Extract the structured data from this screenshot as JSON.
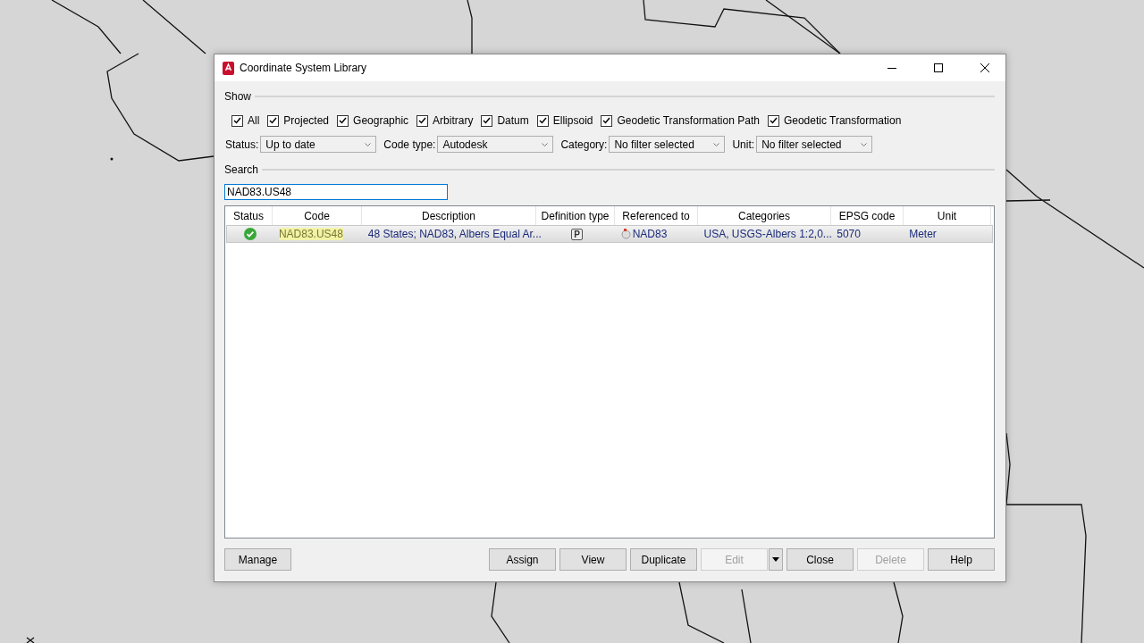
{
  "window": {
    "title": "Coordinate System Library"
  },
  "show": {
    "label": "Show",
    "filters": [
      {
        "label": "All",
        "checked": true
      },
      {
        "label": "Projected",
        "checked": true
      },
      {
        "label": "Geographic",
        "checked": true
      },
      {
        "label": "Arbitrary",
        "checked": true
      },
      {
        "label": "Datum",
        "checked": true
      },
      {
        "label": "Ellipsoid",
        "checked": true
      },
      {
        "label": "Geodetic Transformation Path",
        "checked": true
      },
      {
        "label": "Geodetic Transformation",
        "checked": true
      }
    ]
  },
  "dropdowns": [
    {
      "label": "Status:",
      "value": "Up to date"
    },
    {
      "label": "Code type:",
      "value": "Autodesk"
    },
    {
      "label": "Category:",
      "value": "No filter selected"
    },
    {
      "label": "Unit:",
      "value": "No filter selected"
    }
  ],
  "search": {
    "label": "Search",
    "value": "NAD83.US48"
  },
  "table": {
    "columns": [
      "Status",
      "Code",
      "Description",
      "Definition type",
      "Referenced to",
      "Categories",
      "EPSG code",
      "Unit"
    ],
    "rows": [
      {
        "selected": true,
        "kind": "ok",
        "code": "NAD83.US48",
        "code_highlighted": true,
        "description": "48 States; NAD83, Albers Equal Ar...",
        "definition_type": "P",
        "referenced_to": "NAD83",
        "categories": "USA, USGS-Albers 1:2,0...",
        "epsg_code": "5070",
        "unit": "Meter"
      }
    ]
  },
  "buttons_left": [
    {
      "label": "Manage",
      "disabled": false,
      "kind": "plain"
    }
  ],
  "buttons_right": [
    {
      "label": "Assign",
      "disabled": false,
      "kind": "plain"
    },
    {
      "label": "View",
      "disabled": false,
      "kind": "plain"
    },
    {
      "label": "Duplicate",
      "disabled": false,
      "kind": "plain"
    },
    {
      "label": "Edit",
      "disabled": true,
      "kind": "split"
    },
    {
      "label": "Close",
      "disabled": false,
      "kind": "plain"
    },
    {
      "label": "Delete",
      "disabled": true,
      "kind": "plain"
    },
    {
      "label": "Help",
      "disabled": false,
      "kind": "plain"
    }
  ]
}
